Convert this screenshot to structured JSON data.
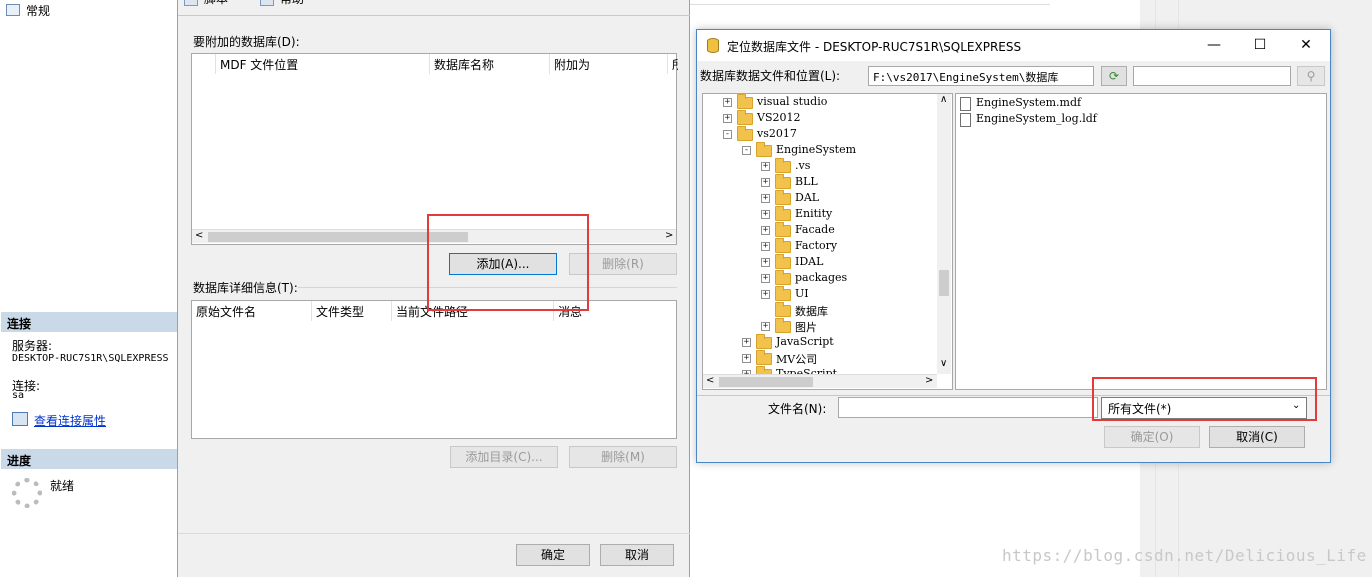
{
  "left_pane": {
    "general_item": "常规",
    "connection_header": "连接",
    "server_label": "服务器:",
    "server_value": "DESKTOP-RUC7S1R\\SQLEXPRESS",
    "connection_label": "连接:",
    "connection_value": "sa",
    "view_connection_properties": "查看连接属性",
    "progress_header": "进度",
    "progress_status": "就绪"
  },
  "attach_dialog": {
    "toolbar_script": "脚本",
    "toolbar_help": "帮助",
    "databases_to_attach_label": "要附加的数据库(D):",
    "top_columns": [
      "MDF 文件位置",
      "数据库名称",
      "附加为",
      "所"
    ],
    "add_button": "添加(A)...",
    "remove_button": "删除(R)",
    "details_label": "数据库详细信息(T):",
    "detail_columns": [
      "原始文件名",
      "文件类型",
      "当前文件路径",
      "消息"
    ],
    "add_catalog_button": "添加目录(C)...",
    "remove_details_button": "删除(M)",
    "ok_button": "确定",
    "cancel_button": "取消"
  },
  "locate_dialog": {
    "title": "定位数据库文件 - DESKTOP-RUC7S1R\\SQLEXPRESS",
    "minimize": "—",
    "maximize": "☐",
    "close": "✕",
    "path_label": "数据库数据文件和位置(L):",
    "path_value": "F:\\vs2017\\EngineSystem\\数据库",
    "search_value": "",
    "tree": [
      {
        "label": "visual studio",
        "expander": "+"
      },
      {
        "label": "VS2012",
        "expander": "+"
      },
      {
        "label": "vs2017",
        "expander": "-"
      },
      {
        "label": "EngineSystem",
        "expander": "-"
      },
      {
        "label": ".vs",
        "expander": "+"
      },
      {
        "label": "BLL",
        "expander": "+"
      },
      {
        "label": "DAL",
        "expander": "+"
      },
      {
        "label": "Enitity",
        "expander": "+"
      },
      {
        "label": "Facade",
        "expander": "+"
      },
      {
        "label": "Factory",
        "expander": "+"
      },
      {
        "label": "IDAL",
        "expander": "+"
      },
      {
        "label": "packages",
        "expander": "+"
      },
      {
        "label": "UI",
        "expander": "+"
      },
      {
        "label": "数据库",
        "expander": ""
      },
      {
        "label": "图片",
        "expander": "+"
      },
      {
        "label": "JavaScript",
        "expander": "+"
      },
      {
        "label": "MV公司",
        "expander": "+"
      },
      {
        "label": "TypeScript",
        "expander": "+"
      }
    ],
    "files": [
      "EngineSystem.mdf",
      "EngineSystem_log.ldf"
    ],
    "filename_label": "文件名(N):",
    "filename_value": "",
    "filter_value": "所有文件(*)",
    "ok_button": "确定(O)",
    "cancel_button": "取消(C)"
  },
  "watermark": "https://blog.csdn.net/Delicious_Life"
}
